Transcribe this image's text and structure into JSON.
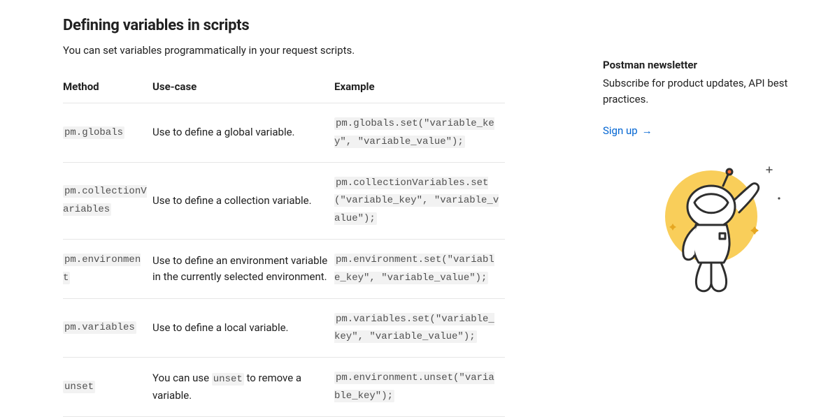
{
  "heading": "Defining variables in scripts",
  "intro": "You can set variables programmatically in your request scripts.",
  "table": {
    "headers": {
      "method": "Method",
      "usecase": "Use-case",
      "example": "Example"
    },
    "rows": [
      {
        "method": "pm.globals",
        "usecase_pre": "Use to define a global variable.",
        "usecase_code": "",
        "usecase_post": "",
        "example": "pm.globals.set(\"variable_key\", \"variable_value\");"
      },
      {
        "method": "pm.collectionVariables",
        "usecase_pre": "Use to define a collection variable.",
        "usecase_code": "",
        "usecase_post": "",
        "example": "pm.collectionVariables.set(\"variable_key\", \"variable_value\");"
      },
      {
        "method": "pm.environment",
        "usecase_pre": "Use to define an environment variable in the currently selected environment.",
        "usecase_code": "",
        "usecase_post": "",
        "example": "pm.environment.set(\"variable_key\", \"variable_value\");"
      },
      {
        "method": "pm.variables",
        "usecase_pre": "Use to define a local variable.",
        "usecase_code": "",
        "usecase_post": "",
        "example": "pm.variables.set(\"variable_key\", \"variable_value\");"
      },
      {
        "method": "unset",
        "usecase_pre": "You can use ",
        "usecase_code": "unset",
        "usecase_post": " to remove a variable.",
        "example": "pm.environment.unset(\"variable_key\");"
      }
    ]
  },
  "sidebar": {
    "newsletter_title": "Postman newsletter",
    "newsletter_desc": "Subscribe for product updates, API best practices.",
    "signup_label": "Sign up",
    "signup_arrow": "→"
  }
}
